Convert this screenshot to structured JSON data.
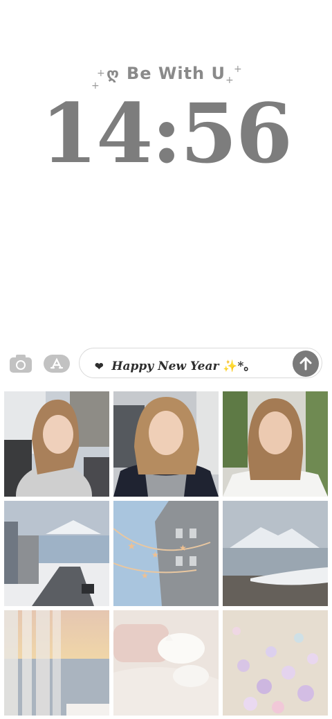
{
  "widget": {
    "tagline": "Be With U",
    "heart_icon": "heart-doodle-icon",
    "time": "14:56"
  },
  "composer": {
    "camera_icon": "camera-icon",
    "appstore_icon": "app-store-icon",
    "message_prefix": "❤",
    "message_text": "Happy New Year",
    "message_suffix": "✨*。",
    "send_icon": "arrow-up-icon"
  },
  "photos": [
    {
      "subject": "portrait-1"
    },
    {
      "subject": "portrait-2"
    },
    {
      "subject": "portrait-3"
    },
    {
      "subject": "snowy-street"
    },
    {
      "subject": "star-garland-building"
    },
    {
      "subject": "snowy-mountain-lake"
    },
    {
      "subject": "sunset-curtain-sea"
    },
    {
      "subject": "cat-on-bed"
    },
    {
      "subject": "flower-petals"
    }
  ],
  "colors": {
    "clock": "#7d7d7d",
    "send_button": "#7a7a7a",
    "icon_gray": "#c2c2c2"
  }
}
